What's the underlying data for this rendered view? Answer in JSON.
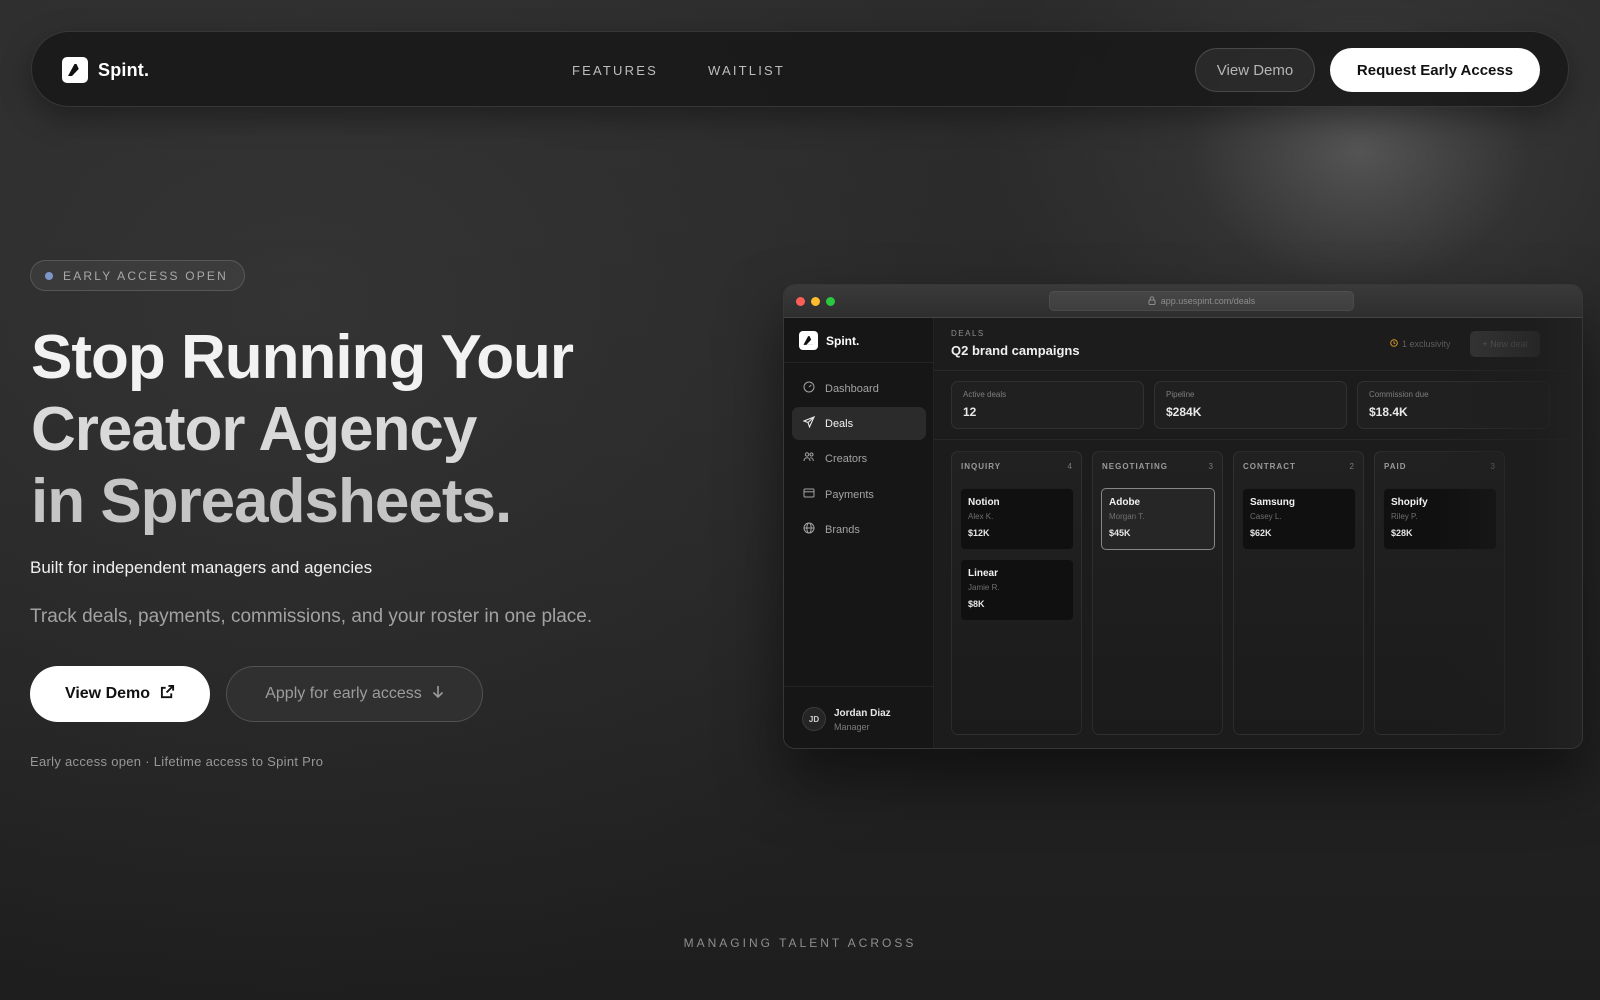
{
  "nav": {
    "brand": "Spint.",
    "links": [
      "FEATURES",
      "WAITLIST"
    ],
    "demo_label": "View Demo",
    "cta_label": "Request Early Access"
  },
  "hero": {
    "badge": "EARLY ACCESS OPEN",
    "headline": [
      "Stop Running Your",
      "Creator Agency",
      "in Spreadsheets."
    ],
    "subhead": "Built for independent managers and agencies",
    "lede": "Track deals, payments, commissions, and your roster in one place.",
    "primary_cta": "View Demo",
    "secondary_cta": "Apply for early access",
    "footnote": "Early access open · Lifetime access to Spint Pro",
    "trust_heading": "MANAGING TALENT ACROSS"
  },
  "app": {
    "url": "app.usespint.com/deals",
    "brand": "Spint.",
    "sidebar": [
      {
        "label": "Dashboard",
        "icon": "gauge-icon"
      },
      {
        "label": "Deals",
        "icon": "send-icon",
        "active": true
      },
      {
        "label": "Creators",
        "icon": "people-icon"
      },
      {
        "label": "Payments",
        "icon": "card-icon"
      },
      {
        "label": "Brands",
        "icon": "globe-icon"
      }
    ],
    "user": {
      "initials": "JD",
      "name": "Jordan Diaz",
      "role": "Manager"
    },
    "eyebrow": "DEALS",
    "title": "Q2 brand campaigns",
    "exclusivity": "1 exclusivity",
    "new_deal": "+ New deal",
    "stats": [
      {
        "label": "Active deals",
        "value": "12"
      },
      {
        "label": "Pipeline",
        "value": "$284K"
      },
      {
        "label": "Commission due",
        "value": "$18.4K"
      }
    ],
    "columns": [
      {
        "name": "INQUIRY",
        "count": "4",
        "cards": [
          {
            "brand": "Notion",
            "person": "Alex K.",
            "amount": "$12K"
          },
          {
            "brand": "Linear",
            "person": "Jamie R.",
            "amount": "$8K"
          }
        ]
      },
      {
        "name": "NEGOTIATING",
        "count": "3",
        "cards": [
          {
            "brand": "Adobe",
            "person": "Morgan T.",
            "amount": "$45K",
            "selected": true
          }
        ]
      },
      {
        "name": "CONTRACT",
        "count": "2",
        "cards": [
          {
            "brand": "Samsung",
            "person": "Casey L.",
            "amount": "$62K"
          }
        ]
      },
      {
        "name": "PAID",
        "count": "3",
        "cards": [
          {
            "brand": "Shopify",
            "person": "Riley P.",
            "amount": "$28K"
          }
        ]
      }
    ]
  },
  "colors": {
    "background": "#1f1f1f",
    "accent_dot": "#7c96c8",
    "exclusivity_dot": "#d4962a",
    "traffic_red": "#ff5f57",
    "traffic_yellow": "#febc2e",
    "traffic_green": "#28c840"
  }
}
